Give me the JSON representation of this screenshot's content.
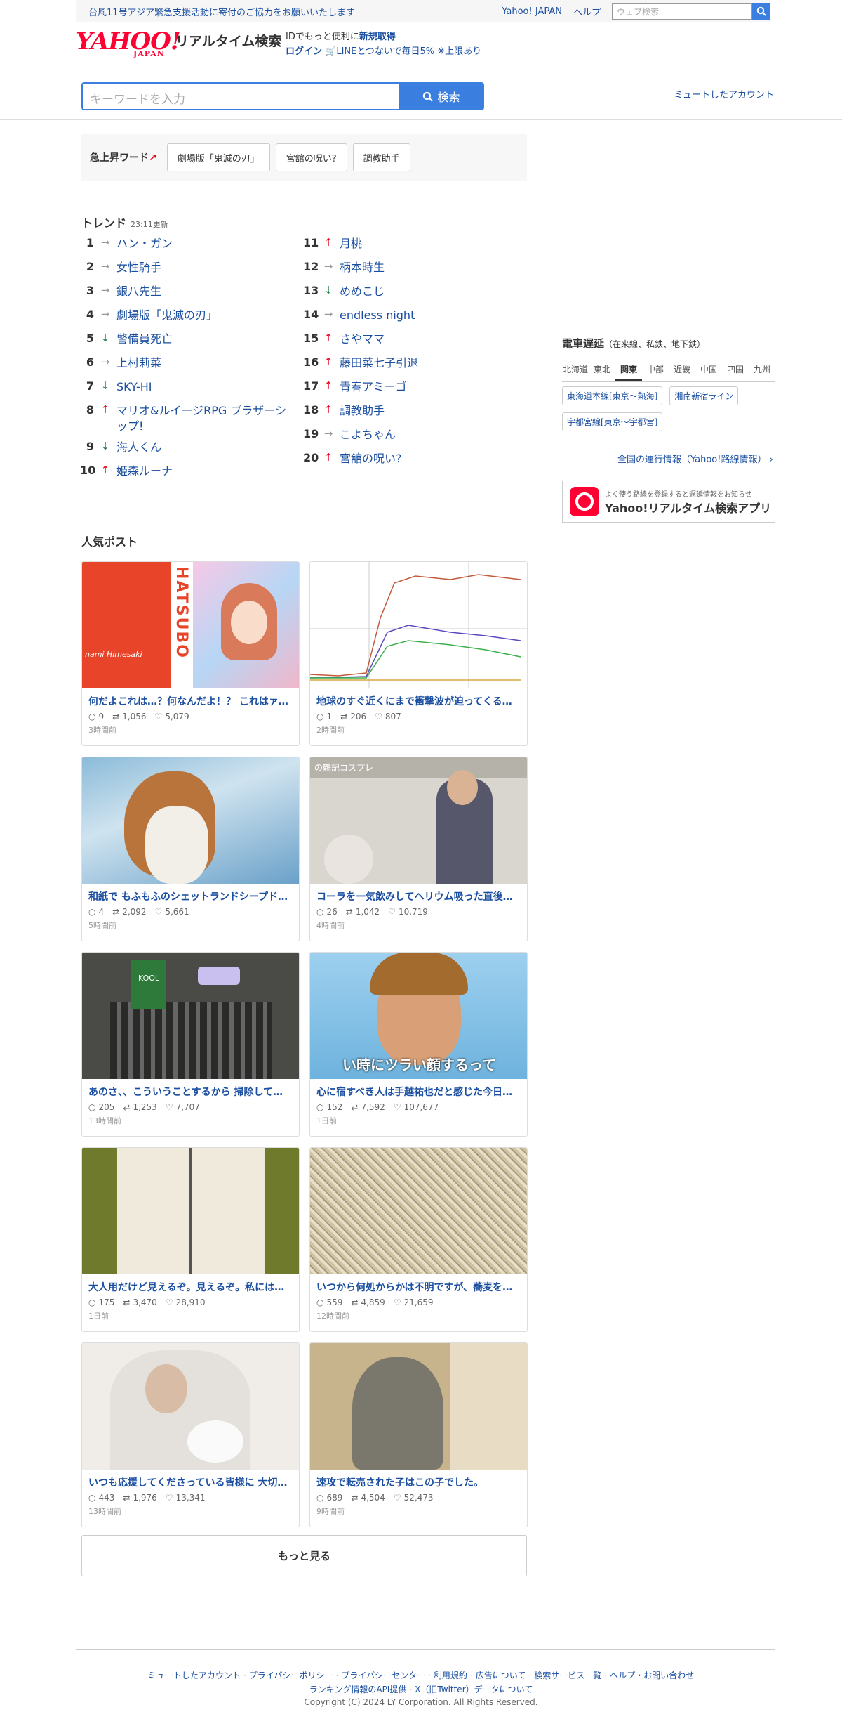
{
  "topbar": {
    "notice": "台風11号アジア緊急支援活動に寄付のご協力をお願いいたします",
    "yahoo_japan": "Yahoo! JAPAN",
    "help": "ヘルプ",
    "web_search_placeholder": "ウェブ検索"
  },
  "header": {
    "logo_text": "YAHOO!",
    "logo_sub": "JAPAN",
    "service_name": "リアルタイム検索",
    "id_text": "IDでもっと便利に",
    "signup": "新規取得",
    "login": "ログイン",
    "line_promo": "LINEとつないで毎日5% ※上限あり"
  },
  "search": {
    "placeholder": "キーワードを入力",
    "button": "検索",
    "muted_accounts": "ミュートしたアカウント"
  },
  "rising": {
    "label": "急上昇ワード",
    "words": [
      "劇場版「鬼滅の刃」",
      "宮舘の呪い?",
      "調教助手"
    ]
  },
  "trend": {
    "title": "トレンド",
    "updated": "23:11更新",
    "left": [
      {
        "rank": "1",
        "dir": "flat",
        "word": "ハン・ガン"
      },
      {
        "rank": "2",
        "dir": "flat",
        "word": "女性騎手"
      },
      {
        "rank": "3",
        "dir": "flat",
        "word": "銀八先生"
      },
      {
        "rank": "4",
        "dir": "flat",
        "word": "劇場版「鬼滅の刃」"
      },
      {
        "rank": "5",
        "dir": "down",
        "word": "警備員死亡"
      },
      {
        "rank": "6",
        "dir": "flat",
        "word": "上村莉菜"
      },
      {
        "rank": "7",
        "dir": "down",
        "word": "SKY-HI"
      },
      {
        "rank": "8",
        "dir": "up",
        "word": "マリオ&ルイージRPG ブラザーシップ!"
      },
      {
        "rank": "9",
        "dir": "down",
        "word": "海人くん"
      },
      {
        "rank": "10",
        "dir": "up",
        "word": "姫森ルーナ"
      }
    ],
    "right": [
      {
        "rank": "11",
        "dir": "up",
        "word": "月桃"
      },
      {
        "rank": "12",
        "dir": "flat",
        "word": "柄本時生"
      },
      {
        "rank": "13",
        "dir": "down",
        "word": "めめこじ"
      },
      {
        "rank": "14",
        "dir": "flat",
        "word": "endless night"
      },
      {
        "rank": "15",
        "dir": "up",
        "word": "さやママ"
      },
      {
        "rank": "16",
        "dir": "up",
        "word": "藤田菜七子引退"
      },
      {
        "rank": "17",
        "dir": "up",
        "word": "青春アミーゴ"
      },
      {
        "rank": "18",
        "dir": "up",
        "word": "調教助手"
      },
      {
        "rank": "19",
        "dir": "flat",
        "word": "こよちゃん"
      },
      {
        "rank": "20",
        "dir": "up",
        "word": "宮舘の呪い?"
      }
    ]
  },
  "trains": {
    "title": "電車遅延",
    "subtitle": "（在来線、私鉄、地下鉄）",
    "tabs": [
      "北海道",
      "東北",
      "関東",
      "中部",
      "近畿",
      "中国",
      "四国",
      "九州"
    ],
    "active_tab": "関東",
    "lines": [
      "東海道本線[東京〜熱海]",
      "湘南新宿ライン",
      "宇都宮線[東京〜宇都宮]"
    ],
    "more": "全国の運行情報（Yahoo!路線情報）"
  },
  "app_banner": {
    "line1": "よく使う路線を登録すると遅延情報をお知らせ",
    "line2": "Yahoo!リアルタイム検索アプリ"
  },
  "popular": {
    "title": "人気ポスト",
    "posts": [
      {
        "text": "何だよこれは…？何なんだよ！？ これはァ…",
        "replies": "9",
        "retweets": "1,056",
        "likes": "5,079",
        "time": "3時間前",
        "img_text": "HATSUBO",
        "img_sub": "nami Himesaki"
      },
      {
        "text": "地球のすぐ近くにまで衝撃波が迫ってくる…",
        "replies": "1",
        "retweets": "206",
        "likes": "807",
        "time": "2時間前"
      },
      {
        "text": "和紙で もふもふのシェットランドシープド…",
        "replies": "4",
        "retweets": "2,092",
        "likes": "5,661",
        "time": "5時間前"
      },
      {
        "text": "コーラを一気飲みしてヘリウム吸った直後…",
        "replies": "26",
        "retweets": "1,042",
        "likes": "10,719",
        "time": "4時間前",
        "img_text": "の鶴記コスプレ"
      },
      {
        "text": "あのさ、、こういうことするから 掃除して…",
        "replies": "205",
        "retweets": "1,253",
        "likes": "7,707",
        "time": "13時間前",
        "img_text": "KOOL"
      },
      {
        "text": "心に宿すべき人は手越祐也だと感じた今日…",
        "replies": "152",
        "retweets": "7,592",
        "likes": "107,677",
        "time": "1日前",
        "img_text": "い時にツラい顔するって"
      },
      {
        "text": "大人用だけど見えるぞ。見えるぞ。私には…",
        "replies": "175",
        "retweets": "3,470",
        "likes": "28,910",
        "time": "1日前"
      },
      {
        "text": "いつから何処からかは不明ですが、蕎麦を…",
        "replies": "559",
        "retweets": "4,859",
        "likes": "21,659",
        "time": "12時間前"
      },
      {
        "text": "いつも応援してくださっている皆様に 大切…",
        "replies": "443",
        "retweets": "1,976",
        "likes": "13,341",
        "time": "13時間前"
      },
      {
        "text": "速攻で転売された子はこの子でした。",
        "replies": "689",
        "retweets": "4,504",
        "likes": "52,473",
        "time": "9時間前"
      }
    ],
    "more": "もっと見る"
  },
  "footer": {
    "links1": [
      "ミュートしたアカウント",
      "プライバシーポリシー",
      "プライバシーセンター",
      "利用規約",
      "広告について",
      "検索サービス一覧",
      "ヘルプ・お問い合わせ"
    ],
    "links2": [
      "ランキング情報のAPI提供",
      "X（旧Twitter）データについて"
    ],
    "copyright": "Copyright (C) 2024 LY Corporation. All Rights Reserved."
  },
  "colors": {
    "brand": "#ff0033",
    "link": "#1a4ea0",
    "accent": "#3a7fe0",
    "up": "#e60012",
    "down": "#2a7a4a"
  }
}
